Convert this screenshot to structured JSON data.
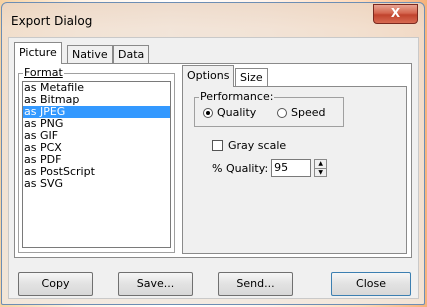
{
  "window": {
    "title": "Export Dialog",
    "close_glyph": "X"
  },
  "outer_tabs": [
    {
      "label": "Picture",
      "active": true
    },
    {
      "label": "Native",
      "active": false
    },
    {
      "label": "Data",
      "active": false
    }
  ],
  "format": {
    "label": "Format",
    "items": [
      "as Metafile",
      "as Bitmap",
      "as JPEG",
      "as PNG",
      "as GIF",
      "as PCX",
      "as PDF",
      "as PostScript",
      "as SVG"
    ],
    "selected": "as JPEG"
  },
  "inner_tabs": [
    {
      "label": "Options",
      "active": true
    },
    {
      "label": "Size",
      "active": false
    }
  ],
  "options": {
    "performance_label": "Performance:",
    "quality_label": "Quality",
    "speed_label": "Speed",
    "selected": "Quality",
    "grayscale_label": "Gray scale",
    "grayscale_checked": false,
    "quality_percent_label": "% Quality:",
    "quality_value": "95"
  },
  "buttons": {
    "copy": "Copy",
    "save": "Save...",
    "send": "Send...",
    "close": "Close"
  },
  "colors": {
    "selection": "#3399ff",
    "close_button": "#c7462f"
  }
}
